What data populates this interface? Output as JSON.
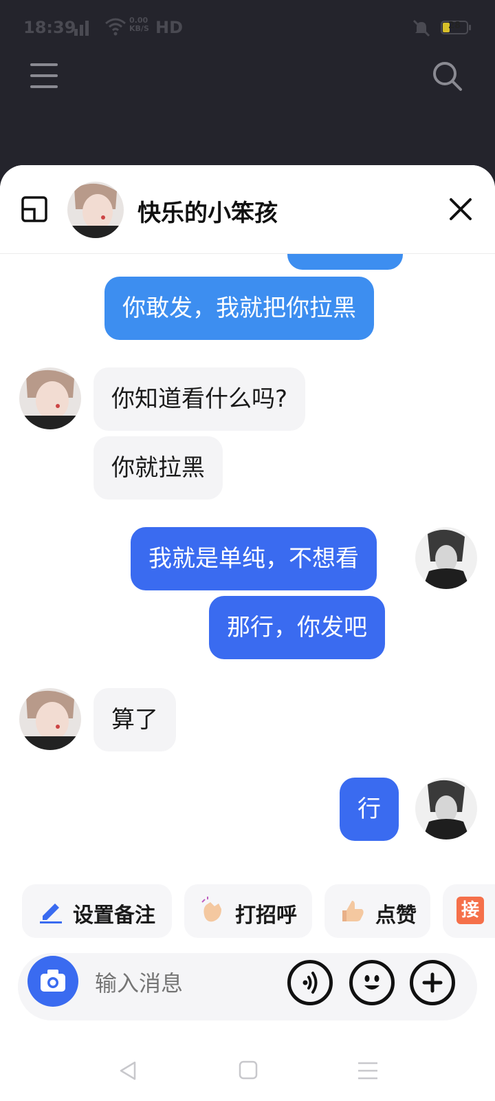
{
  "status_bar": {
    "time": "18:39",
    "network_speed_top": "0.00",
    "network_speed_bottom": "KB/S",
    "hd": "HD",
    "battery": "28"
  },
  "chat": {
    "contact_name": "快乐的小笨孩",
    "messages": [
      {
        "side": "out",
        "text": ""
      },
      {
        "side": "out",
        "text": "你敢发，我就把你拉黑"
      },
      {
        "side": "in",
        "text": "你知道看什么吗?"
      },
      {
        "side": "in",
        "text": "你就拉黑"
      },
      {
        "side": "out",
        "text": "我就是单纯，不想看"
      },
      {
        "side": "out",
        "text": "那行，你发吧"
      },
      {
        "side": "in",
        "text": "算了"
      },
      {
        "side": "out",
        "text": "行"
      }
    ]
  },
  "quick_actions": [
    {
      "label": "设置备注",
      "icon": "pencil-icon"
    },
    {
      "label": "打招呼",
      "icon": "wave-hand-icon"
    },
    {
      "label": "点赞",
      "icon": "thumbs-up-icon"
    },
    {
      "label": "接",
      "icon": "accept-badge-icon"
    }
  ],
  "input": {
    "placeholder": "输入消息"
  },
  "colors": {
    "accent": "#3a6bf0",
    "accent_light": "#3d8ef0",
    "incoming_bubble": "#f4f4f6",
    "background_dark": "#24242c"
  }
}
